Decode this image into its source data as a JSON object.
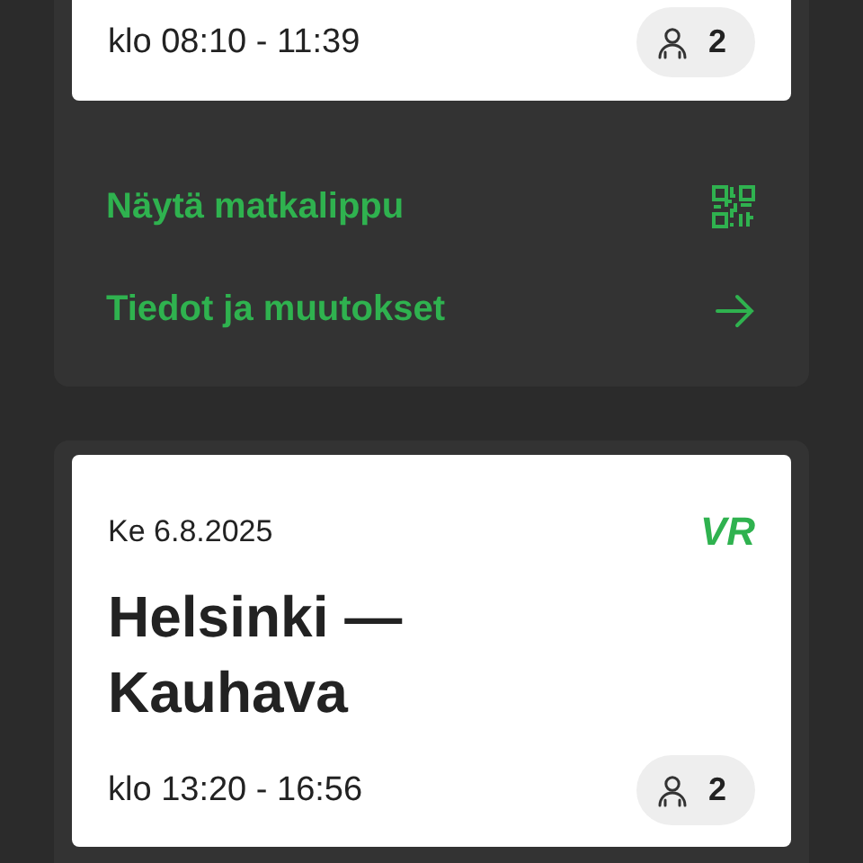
{
  "trips": [
    {
      "time": "klo 08:10 - 11:39",
      "passengers": "2",
      "actions": [
        {
          "label": "Näytä matkalippu",
          "kind": "qr"
        },
        {
          "label": "Tiedot ja muutokset",
          "kind": "arrow"
        }
      ]
    },
    {
      "date": "Ke 6.8.2025",
      "route": "Helsinki —\nKauhava",
      "time": "klo 13:20 - 16:56",
      "passengers": "2",
      "logo": "VR"
    }
  ]
}
